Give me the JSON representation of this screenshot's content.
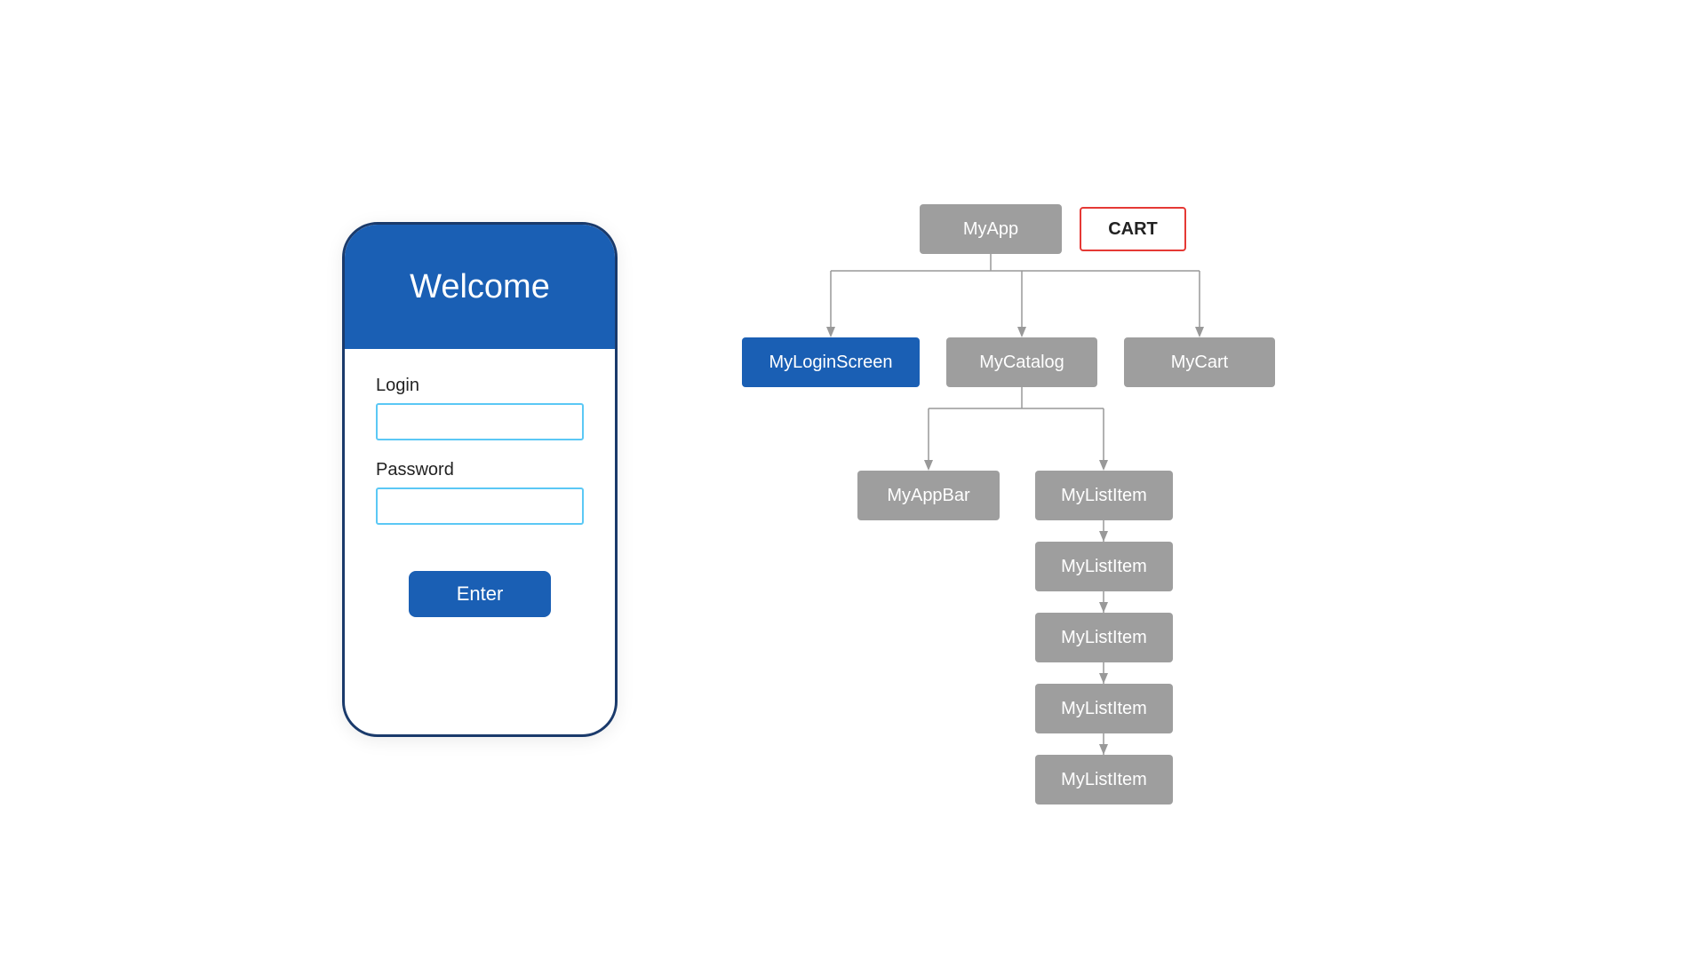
{
  "phone": {
    "header_title": "Welcome",
    "login_label": "Login",
    "login_placeholder": "",
    "password_label": "Password",
    "password_placeholder": "",
    "enter_button": "Enter"
  },
  "tree": {
    "myapp_label": "MyApp",
    "cart_label": "CART",
    "myloginscreen_label": "MyLoginScreen",
    "mycatalog_label": "MyCatalog",
    "mycart_label": "MyCart",
    "myappbar_label": "MyAppBar",
    "mylistitem_labels": [
      "MyListItem",
      "MyListItem",
      "MyListItem",
      "MyListItem",
      "MyListItem"
    ]
  },
  "colors": {
    "blue": "#1a5fb4",
    "gray": "#9e9e9e",
    "red_border": "#e53935",
    "line_color": "#999999"
  }
}
